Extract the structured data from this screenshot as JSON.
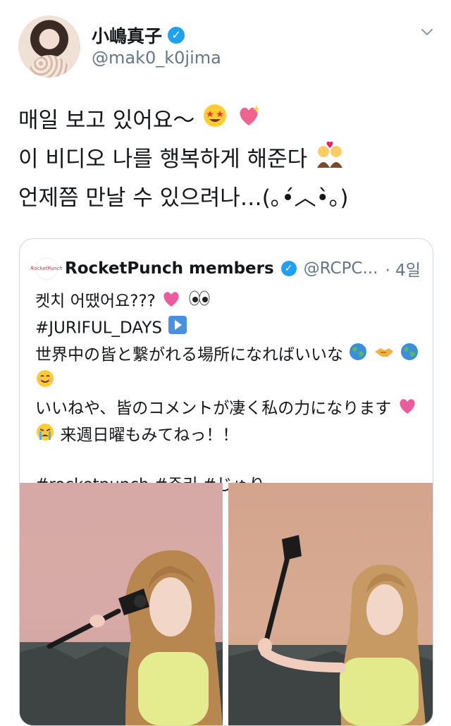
{
  "tweet": {
    "display_name": "小嶋真子",
    "handle": "@mak0_k0jima",
    "lines": [
      "매일 보고 있어요～",
      "이 비디오 나를 행복하게 해준다",
      "언제쯤 만날 수 있으려나…(｡•́︿•̀｡)"
    ],
    "line_emojis": [
      "star-struck-emoji, sparkling-heart-emoji",
      "couple-with-heart-emoji",
      ""
    ]
  },
  "quoted": {
    "avatar_text": "RocketPunch",
    "display_name": "RocketPunch members",
    "handle": "@RCPC...",
    "time": "· 4일",
    "line1": "켓치 어땠어요???",
    "line2": "#JURIFUL_DAYS",
    "line3": "世界中の皆と繋がれる場所になればいいな",
    "line5": "いいねや、皆のコメントが凄く私の力になります",
    "line6": "来週日曜もみてねっ！！",
    "hashtags": "#rocketpunch #쥬리 #じゅり"
  },
  "colors": {
    "accent": "#1da1f2",
    "text": "#14171a",
    "secondary": "#657786",
    "border": "#cfd9de"
  },
  "icons": [
    "verified-badge-icon",
    "chevron-down-icon"
  ]
}
